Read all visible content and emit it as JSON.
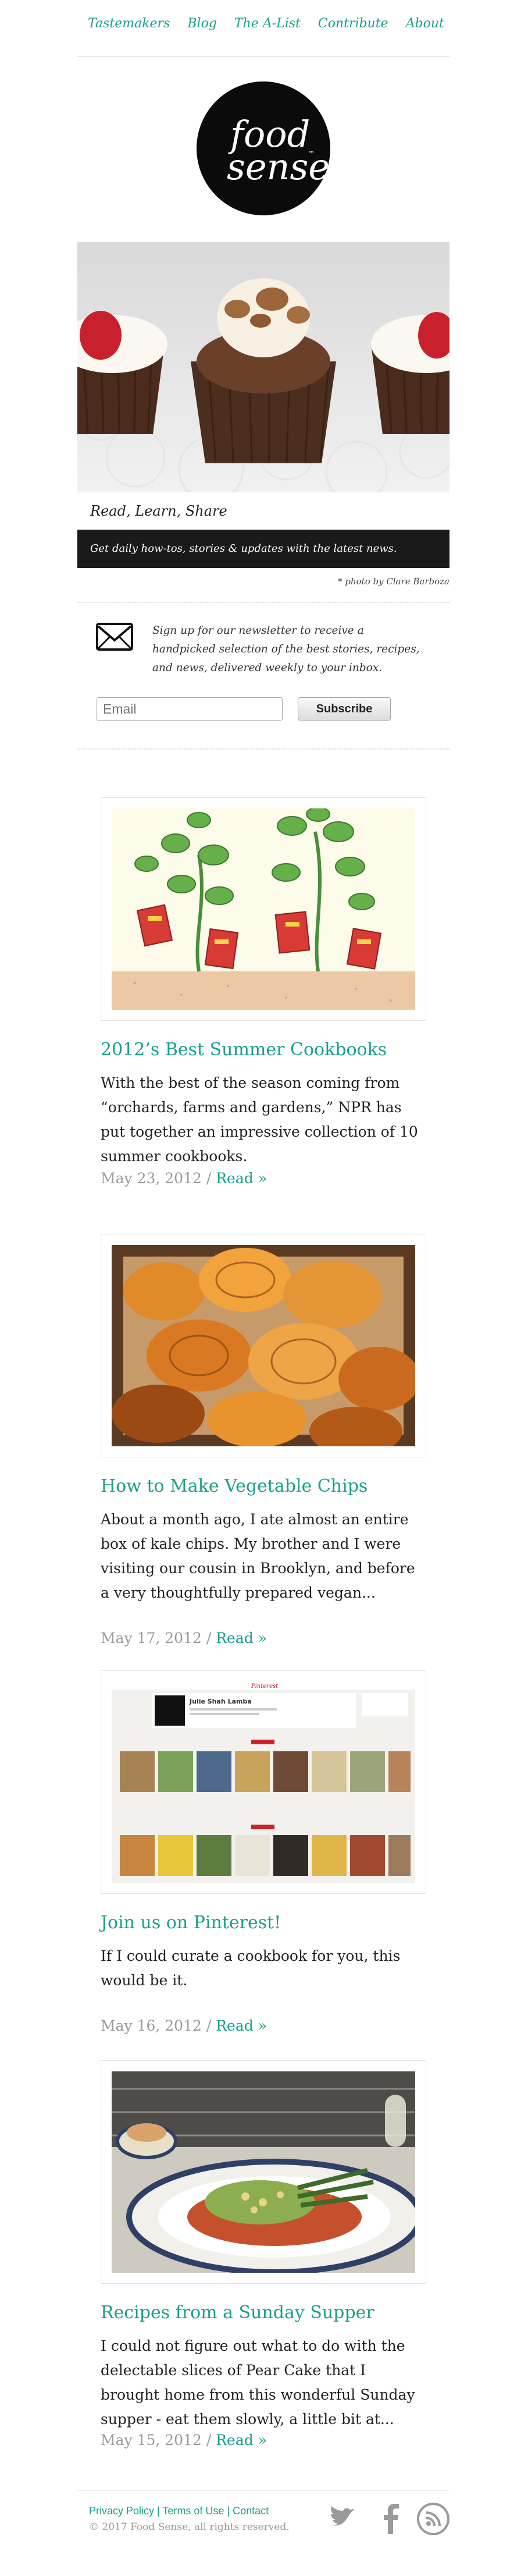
{
  "nav": {
    "items": [
      "Tastemakers",
      "Blog",
      "The A-List",
      "Contribute",
      "About"
    ]
  },
  "logo": {
    "line1": "food",
    "line2": "sense",
    "tm": "™"
  },
  "hero": {
    "caption": "Read, Learn, Share",
    "banner": "Get daily how-tos, stories & updates with the latest news.",
    "photo_credit": "* photo by Clare Barboza"
  },
  "newsletter": {
    "text": "Sign up for our newsletter to receive a handpicked selection of the best stories, recipes, and news, delivered weekly to your inbox.",
    "email_placeholder": "Email",
    "subscribe_label": "Subscribe"
  },
  "articles": [
    {
      "title": "2012’s Best Summer Cookbooks",
      "body": "With the best of the season coming from “orchards, farms and gardens,” NPR has put together an impressive collection of 10 summer cookbooks.",
      "date": "May 23, 2012",
      "sep": " / ",
      "read": "Read »"
    },
    {
      "title": "How to Make Vegetable Chips",
      "body": "About a month ago, I ate almost an entire box of kale chips. My brother and I were visiting our cousin in Brooklyn, and before a very thoughtfully prepared vegan...",
      "date": "May 17, 2012",
      "sep": " / ",
      "read": "Read »"
    },
    {
      "title": "Join us on Pinterest!",
      "body": "If I could curate a cookbook for you, this would be it.",
      "date": "May 16, 2012",
      "sep": " / ",
      "read": "Read »",
      "screenshot": {
        "profile_name": "Julie Shah Lamba",
        "brand": "Pinterest"
      }
    },
    {
      "title": "Recipes from a Sunday Supper",
      "body": "I could not figure out what to do with the delectable slices of Pear Cake that I brought home from this wonderful Sunday supper - eat them slowly, a little bit at...",
      "date": "May 15, 2012",
      "sep": " / ",
      "read": "Read »"
    }
  ],
  "footer": {
    "links": [
      "Privacy Policy",
      "Terms of Use",
      "Contact"
    ],
    "divider": " | ",
    "copyright": "© 2017 Food Sense, all rights reserved."
  },
  "colors": {
    "accent": "#179f8c",
    "meta": "#999999",
    "hero_bar": "#1a1a1a",
    "social_icon": "#9a9a9a"
  },
  "icons": [
    "mail-icon",
    "twitter-icon",
    "facebook-icon",
    "rss-icon"
  ]
}
